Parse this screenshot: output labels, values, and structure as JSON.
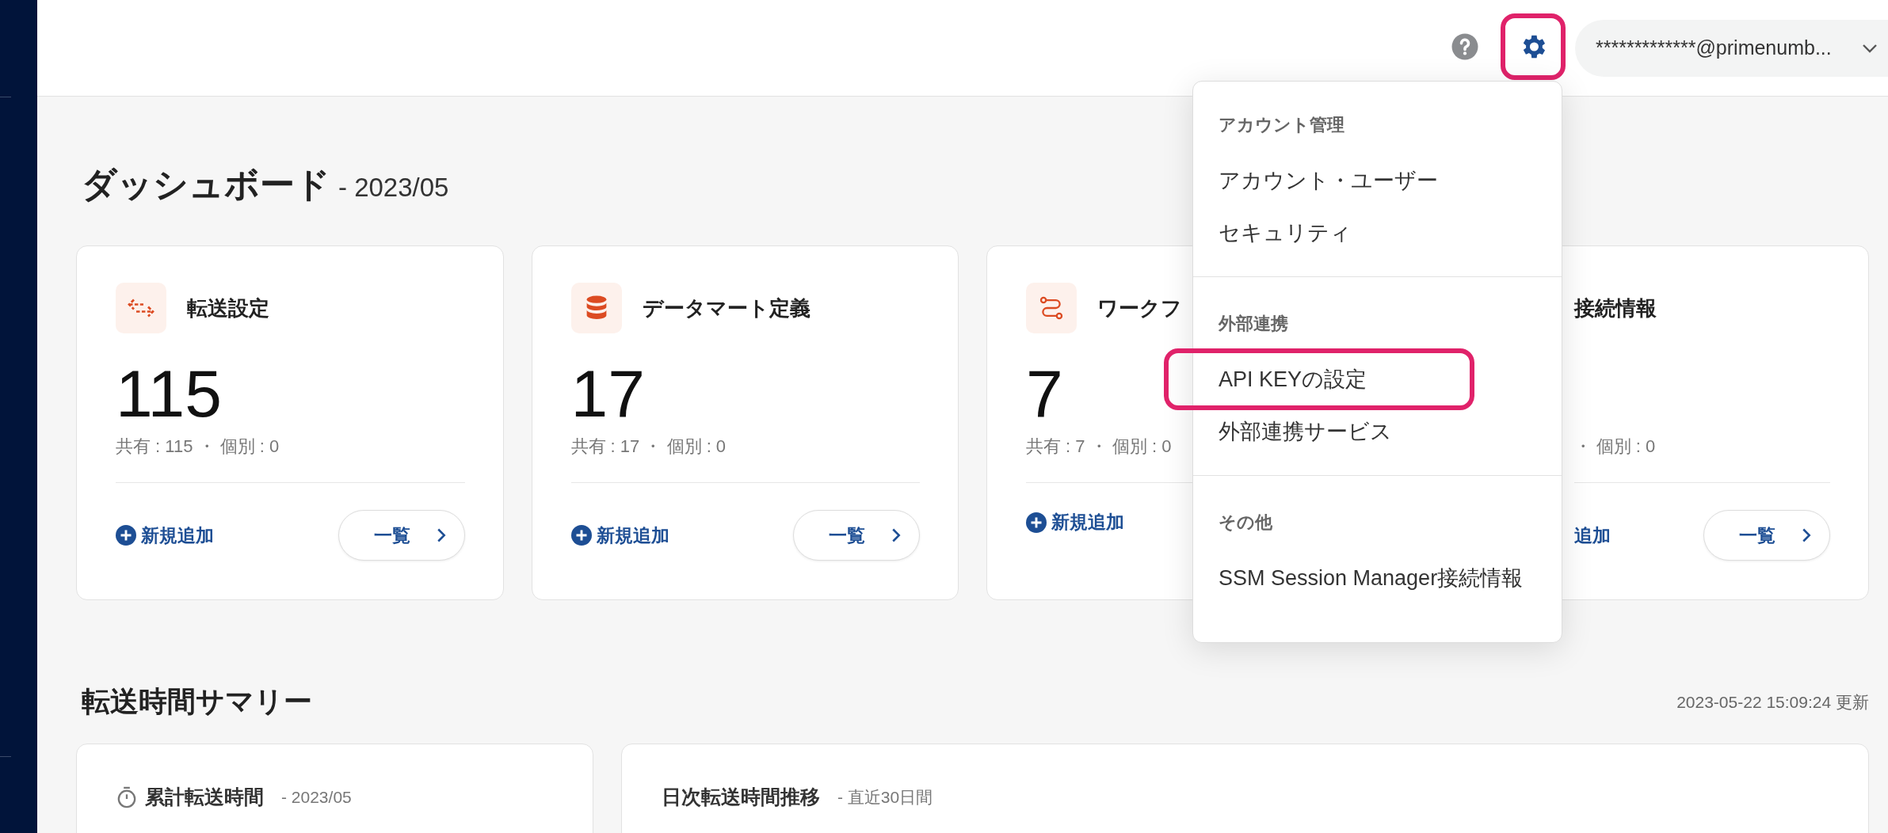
{
  "header": {
    "account": "*************@primenumb...",
    "help_highlighted": false,
    "settings_highlighted": true
  },
  "title": "ダッシュボード",
  "title_period": "- 2023/05",
  "cards": [
    {
      "kind": "transfer",
      "covered": false,
      "title": "転送設定",
      "count": "115",
      "stats": "共有 : 115 ・ 個別 : 0",
      "add_label": "新規追加",
      "add_icon": true,
      "list_label": "一覧"
    },
    {
      "kind": "database",
      "covered": false,
      "title": "データマート定義",
      "count": "17",
      "stats": "共有 : 17 ・ 個別 : 0",
      "add_label": "新規追加",
      "add_icon": true,
      "list_label": "一覧"
    },
    {
      "kind": "workflow",
      "covered": false,
      "title": "ワークフ",
      "count": "7",
      "stats": "共有 : 7 ・ 個別 : 0",
      "add_label": "新規追加",
      "add_icon": true
    },
    {
      "kind": "plain",
      "covered": true,
      "title": "接続情報",
      "stats": "・ 個別 : 0",
      "add_label": "追加",
      "add_icon": false,
      "list_label": "一覧"
    }
  ],
  "menu": {
    "sections": [
      {
        "heading": "アカウント管理",
        "items": [
          {
            "label": "アカウント・ユーザー",
            "highlighted": false
          },
          {
            "label": "セキュリティ",
            "highlighted": false
          }
        ]
      },
      {
        "heading": "外部連携",
        "items": [
          {
            "label": "API KEYの設定",
            "highlighted": true
          },
          {
            "label": "外部連携サービス",
            "highlighted": false
          }
        ]
      },
      {
        "heading": "その他",
        "items": [
          {
            "label": "SSM Session Manager接続情報",
            "highlighted": false
          }
        ]
      }
    ]
  },
  "summary": {
    "title": "転送時間サマリー",
    "updated": "2023-05-22 15:09:24 更新",
    "panels": [
      {
        "kind": "stopwatch",
        "title": "累計転送時間",
        "period": "- 2023/05"
      },
      {
        "kind": "plain",
        "title": "日次転送時間推移",
        "period": "- 直近30日間"
      }
    ]
  }
}
